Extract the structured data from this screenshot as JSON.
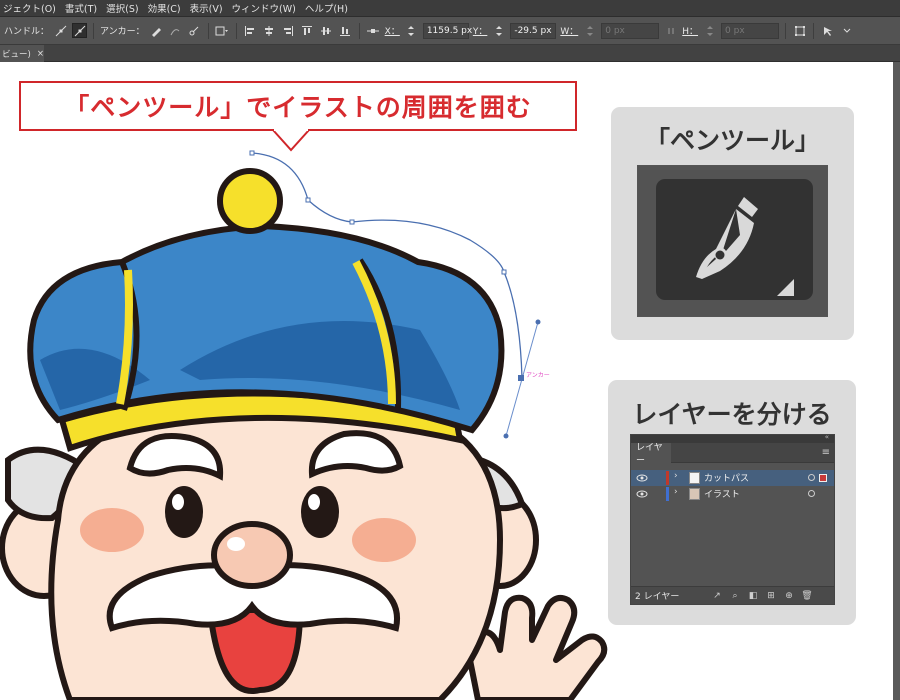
{
  "menu": {
    "items": [
      "ジェクト(O)",
      "書式(T)",
      "選択(S)",
      "効果(C)",
      "表示(V)",
      "ウィンドウ(W)",
      "ヘルプ(H)"
    ]
  },
  "control_bar": {
    "handle_label": "ハンドル：",
    "anchor_label": "アンカー：",
    "x_label": "X：",
    "x_value": "1159.5 px",
    "y_label": "Y：",
    "y_value": "-29.5 px",
    "w_label": "W：",
    "w_value": "0 px",
    "h_label": "H：",
    "h_value": "0 px"
  },
  "document_tab": {
    "label": "ビュー)",
    "close": "×"
  },
  "callout": {
    "text": "「ペンツール」でイラストの周囲を囲む",
    "color": "#d72b2f"
  },
  "pen_card": {
    "title": "「ペンツール」",
    "icon": "pen-tool-icon"
  },
  "layer_card": {
    "title": "レイヤーを分ける",
    "panel_tab": "レイヤー",
    "menu_glyph": "≡",
    "collapse_glyph": "«",
    "layers": [
      {
        "name": "カットパス",
        "color": "#c0392b",
        "selected": true
      },
      {
        "name": "イラスト",
        "color": "#3f6fd1",
        "selected": false
      }
    ],
    "count_label": "2 レイヤー"
  },
  "canvas": {
    "anchor_label": "アンカー"
  }
}
